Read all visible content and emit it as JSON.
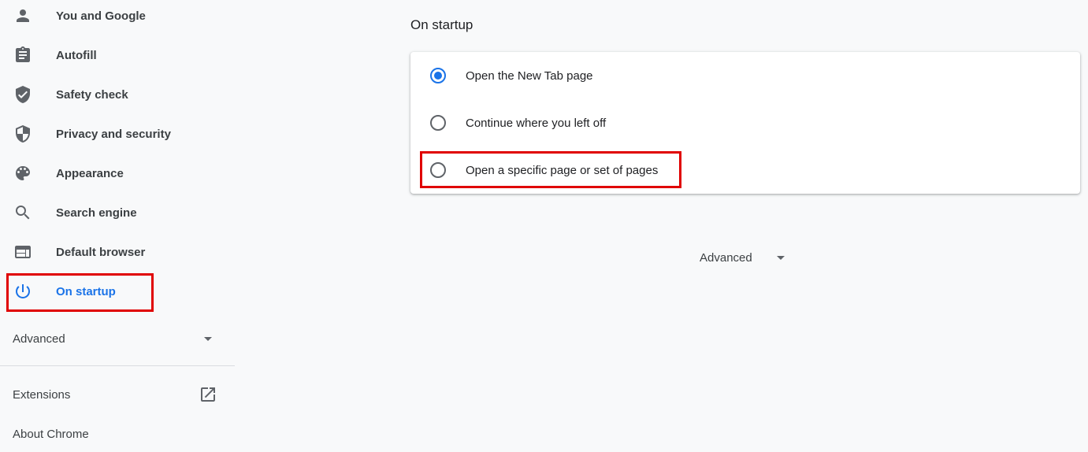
{
  "sidebar": {
    "items": [
      {
        "label": "You and Google",
        "icon": "person-icon"
      },
      {
        "label": "Autofill",
        "icon": "clipboard-icon"
      },
      {
        "label": "Safety check",
        "icon": "shield-check-icon"
      },
      {
        "label": "Privacy and security",
        "icon": "shield-half-icon"
      },
      {
        "label": "Appearance",
        "icon": "palette-icon"
      },
      {
        "label": "Search engine",
        "icon": "search-icon"
      },
      {
        "label": "Default browser",
        "icon": "browser-window-icon"
      },
      {
        "label": "On startup",
        "icon": "power-icon",
        "active": true
      }
    ],
    "advanced_label": "Advanced",
    "extensions_label": "Extensions",
    "about_label": "About Chrome"
  },
  "main": {
    "section_title": "On startup",
    "options": [
      {
        "label": "Open the New Tab page",
        "checked": true
      },
      {
        "label": "Continue where you left off",
        "checked": false
      },
      {
        "label": "Open a specific page or set of pages",
        "checked": false
      }
    ],
    "advanced_label": "Advanced"
  },
  "colors": {
    "accent": "#1a73e8",
    "highlight": "#e00000",
    "background": "#f8f9fa"
  }
}
